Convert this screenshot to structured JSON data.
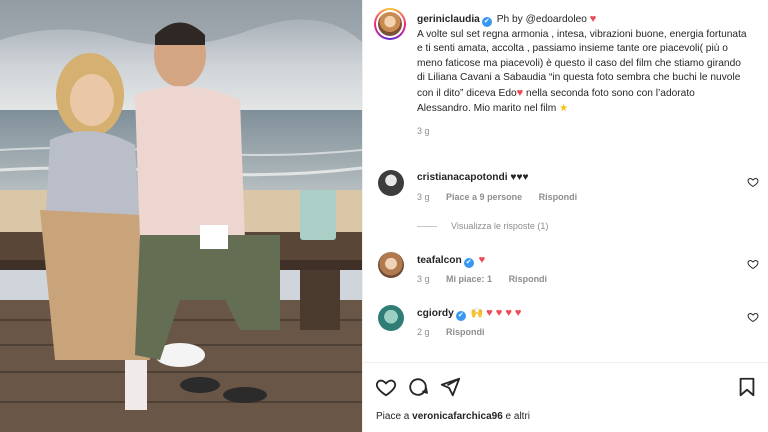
{
  "post": {
    "author": "gerinicl​audia",
    "author_display": "gerinicl",
    "username": "gerinicl",
    "photo_credit_prefix": "Ph by",
    "photo_credit_user": "@edoardoleo",
    "caption": "A volte sul set regna armonia , intesa, vibrazioni buone, energia fortunata e ti senti amata, accolta , passiamo insieme tante ore piacevoli( più o meno faticose ma piacevoli) è questo il caso del film che stiamo girando di Liliana Cavani a Sabaudia “in questa foto sembra che buchi le nuvole con il dito” diceva Edo",
    "caption_tail": "nella seconda foto sono con l’adorato Alessandro. Mio marito nel film",
    "time": "3 g"
  },
  "account": {
    "name": "geriniclaudia"
  },
  "comments": [
    {
      "user": "cristianacapotondi",
      "text": "♥♥♥",
      "time": "3 g",
      "likes": "Piace a 9 persone",
      "reply": "Rispondi",
      "view_replies": "Visualizza le risposte (1)"
    },
    {
      "user": "teafalcon",
      "text": "",
      "time": "3 g",
      "likes": "Mi piace: 1",
      "reply": "Rispondi"
    },
    {
      "user": "cgiordy",
      "text": "",
      "time": "2 g",
      "reply": "Rispondi"
    }
  ],
  "likes_line": {
    "prefix": "Piace a",
    "user": "veronicafarchica96",
    "suffix": "e altri"
  },
  "colors": {
    "verified": "#3897f0",
    "heart": "#ed4956",
    "text": "#262626",
    "muted": "#8e8e8e"
  },
  "icons": [
    "heart-icon",
    "comment-icon",
    "share-icon",
    "bookmark-icon",
    "verified-icon"
  ]
}
